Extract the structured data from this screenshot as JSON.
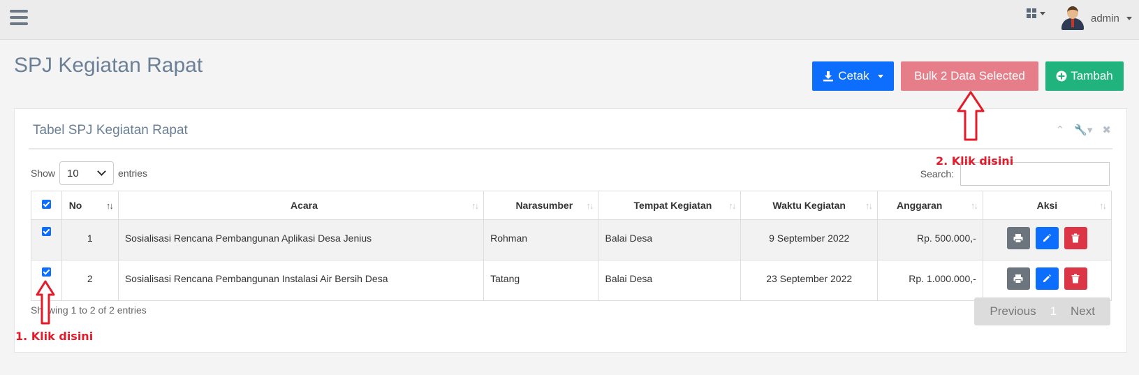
{
  "topbar": {
    "menu_icon": "hamburger-icon",
    "apps_icon": "grid-icon",
    "user_name": "admin"
  },
  "page": {
    "title": "SPJ Kegiatan Rapat"
  },
  "actions": {
    "cetak_label": "Cetak",
    "bulk_label": "Bulk 2 Data Selected",
    "tambah_label": "Tambah"
  },
  "panel": {
    "title": "Tabel SPJ Kegiatan Rapat",
    "show_label": "Show",
    "entries_value": "10",
    "entries_label": "entries",
    "search_label": "Search:",
    "search_value": ""
  },
  "table": {
    "headers": {
      "no": "No",
      "acara": "Acara",
      "narasumber": "Narasumber",
      "tempat": "Tempat Kegiatan",
      "waktu": "Waktu Kegiatan",
      "anggaran": "Anggaran",
      "aksi": "Aksi"
    },
    "rows": [
      {
        "checked": true,
        "no": "1",
        "acara": "Sosialisasi Rencana Pembangunan Aplikasi Desa Jenius",
        "narasumber": "Rohman",
        "tempat": "Balai Desa",
        "waktu": "9 September 2022",
        "anggaran": "Rp. 500.000,-"
      },
      {
        "checked": true,
        "no": "2",
        "acara": "Sosialisasi Rencana Pembangunan Instalasi Air Bersih Desa",
        "narasumber": "Tatang",
        "tempat": "Balai Desa",
        "waktu": "23 September 2022",
        "anggaran": "Rp. 1.000.000,-"
      }
    ]
  },
  "footer": {
    "info": "Showing 1 to 2 of 2 entries",
    "prev_label": "Previous",
    "current_page": "1",
    "next_label": "Next"
  },
  "annotations": {
    "step1": "1. Klik disini",
    "step2": "2. Klik disini"
  },
  "colors": {
    "primary": "#0d6efd",
    "bulk": "#e67e8a",
    "success": "#20b37d",
    "danger": "#dc3545",
    "annotation": "#e21c2a"
  }
}
